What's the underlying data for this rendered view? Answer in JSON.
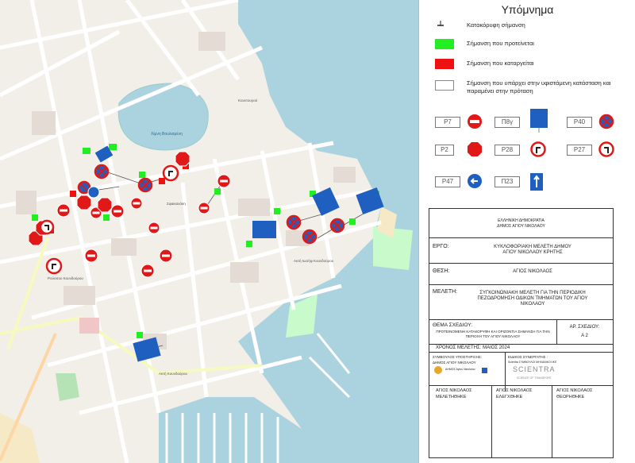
{
  "map": {
    "labels": {
      "lake": "Λίμνη Βουλισμένη",
      "street1": "Κουντουρού",
      "street2": "25ης Μαρτίου",
      "street3": "Σφακιανάκη",
      "street4": "Ακτή Κουνδούρου",
      "street5": "Ακτή Ιωσήφ Κουνδούρου",
      "street6": "Ρούσσου Κουνδούρου"
    }
  },
  "legend": {
    "title": "Υπόμνημα",
    "vertical_sign_label": "Κατακόρυφη σήμανση",
    "proposed_label": "Σήμανση που προτείνεται",
    "removed_label": "Σήμανση που καταργείται",
    "existing_label": "Σήμανση που υπάρχει στην υφιστάμενη κατάσταση και παραμένει στην πρόταση",
    "colors": {
      "proposed": "#22ee22",
      "removed": "#ee1111",
      "existing": "#ffffff"
    },
    "plates": [
      "P7",
      "Π8γ",
      "P40",
      "P2",
      "P28",
      "P27",
      "P47",
      "Π23"
    ]
  },
  "title_block": {
    "authority": "ΕΛΛΗΝΙΚΗ ΔΗΜΟΚΡΑΤΙΑ\nΔΗΜΟΣ ΑΓΙΟΥ ΝΙΚΟΛΑΟΥ",
    "work_label": "ΕΡΓΟ:",
    "work_value": "ΚΥΚΛΟΦΟΡΙΑΚΗ ΜΕΛΕΤΗ ΔΗΜΟΥ\nΑΓΙΟΥ ΝΙΚΟΛΑΟΥ ΚΡΗΤΗΣ",
    "location_label": "ΘΕΣΗ:",
    "location_value": "ΑΓΙΟΣ ΝΙΚΟΛΑΟΣ",
    "study_label": "ΜΕΛΕΤΗ:",
    "study_value": "ΣΥΓΚΟΙΝΩΝΙΑΚΗ ΜΕΛΕΤΗ ΓΙΑ ΤΗΝ ΠΕΡΙΟΔΙΚΗ\nΠΕΖΟΔΡΟΜΗΣΗ ΟΔΙΚΩΝ ΤΜΗΜΑΤΩΝ ΤΟΥ ΑΓΙΟΥ\nΝΙΚΟΛΑΟΥ",
    "drawing_label": "ΘΕΜΑ ΣΧΕΔΙΟΥ:",
    "drawing_value": "ΠΡΟΤΕΙΝΟΜΕΝΗ ΚΑΤΑΚΟΡΥΦΗ ΚΑΙ ΟΡΙΖΟΝΤΙΑ ΣΗΜΑΝΣΗ ΓΙΑ ΤΗΝ\nΠΕΡΙΟΧΗ ΤΟΥ ΑΓΙΟΥ ΝΙΚΟΛΑΟΥ",
    "drawing_no_label": "ΑΡ. ΣΧΕΔΙΟΥ:",
    "drawing_no_value": "Α 2",
    "date_label": "ΧΡΟΝΟΣ ΜΕΛΕΤΗΣ: ΜΑΙΟΣ 2024",
    "support_label": "ΣΥΜΒΟΥΛΟΣ ΥΠΟΣΤΗΡΙΞΗΣ:",
    "support_value": "ΔΗΜΟΣ ΑΓΙΟΥ ΝΙΚΟΛΑΟΥ",
    "partner_label": "ΕΙΔΙΚΟΣ ΣΥΝΕΡΓΑΤΗΣ :",
    "partner_value": "Scientra ΣΥΜΒΟΥΛΟΙ ΜΗΧΑΝΙΚΟΙ ΙΚΕ",
    "logo_left": "ΔΗΜΟΣ Αγίου Νικολάου",
    "logo_right": "SCIENTRA",
    "logo_right_sub": "SCIENCE OF TRANSPORT",
    "sign1_place": "ΑΓΙΟΣ ΝΙΚΟΛΑΟΣ",
    "sign1_role": "ΜΕΛΕΤΗΘΗΚΕ",
    "sign2_place": "ΑΓΙΟΣ ΝΙΚΟΛΑΟΣ",
    "sign2_role": "ΕΛΕΓΧΘΗΚΕ",
    "sign3_place": "ΑΓΙΟΣ ΝΙΚΟΛΑΟΣ",
    "sign3_role": "ΘΕΩΡΗΘΗΚΕ"
  }
}
